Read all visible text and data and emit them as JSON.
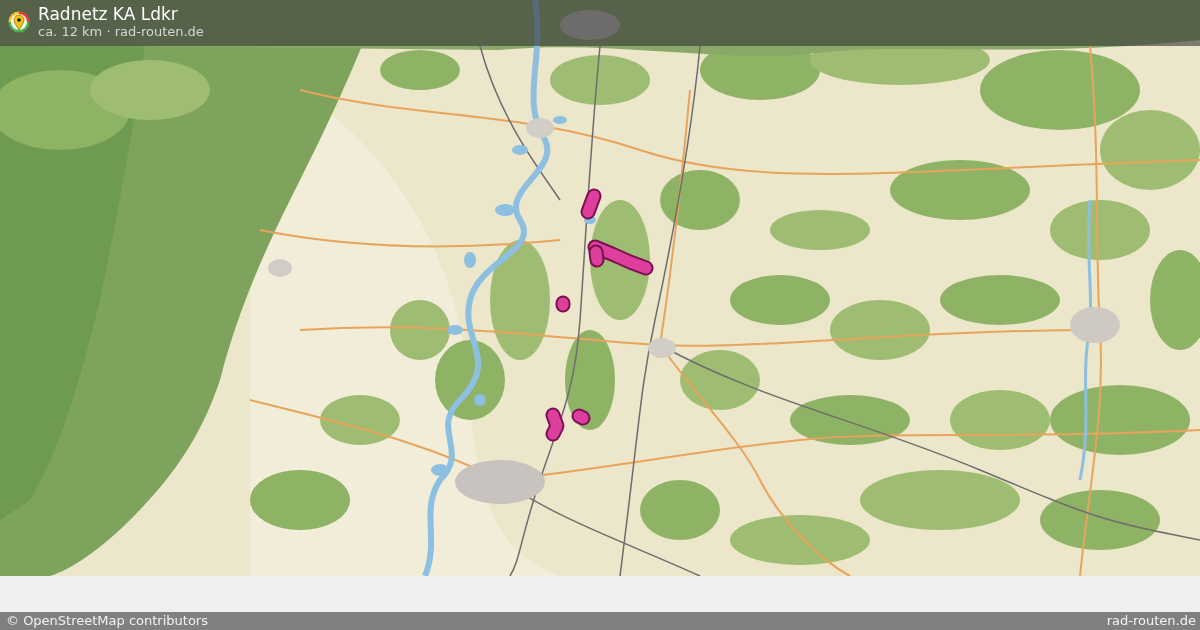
{
  "header": {
    "title": "Radnetz KA Ldkr",
    "subtitle": "ca. 12 km · rad-routen.de"
  },
  "footer": {
    "attribution": "© OpenStreetMap contributors",
    "site": "rad-routen.de"
  }
}
